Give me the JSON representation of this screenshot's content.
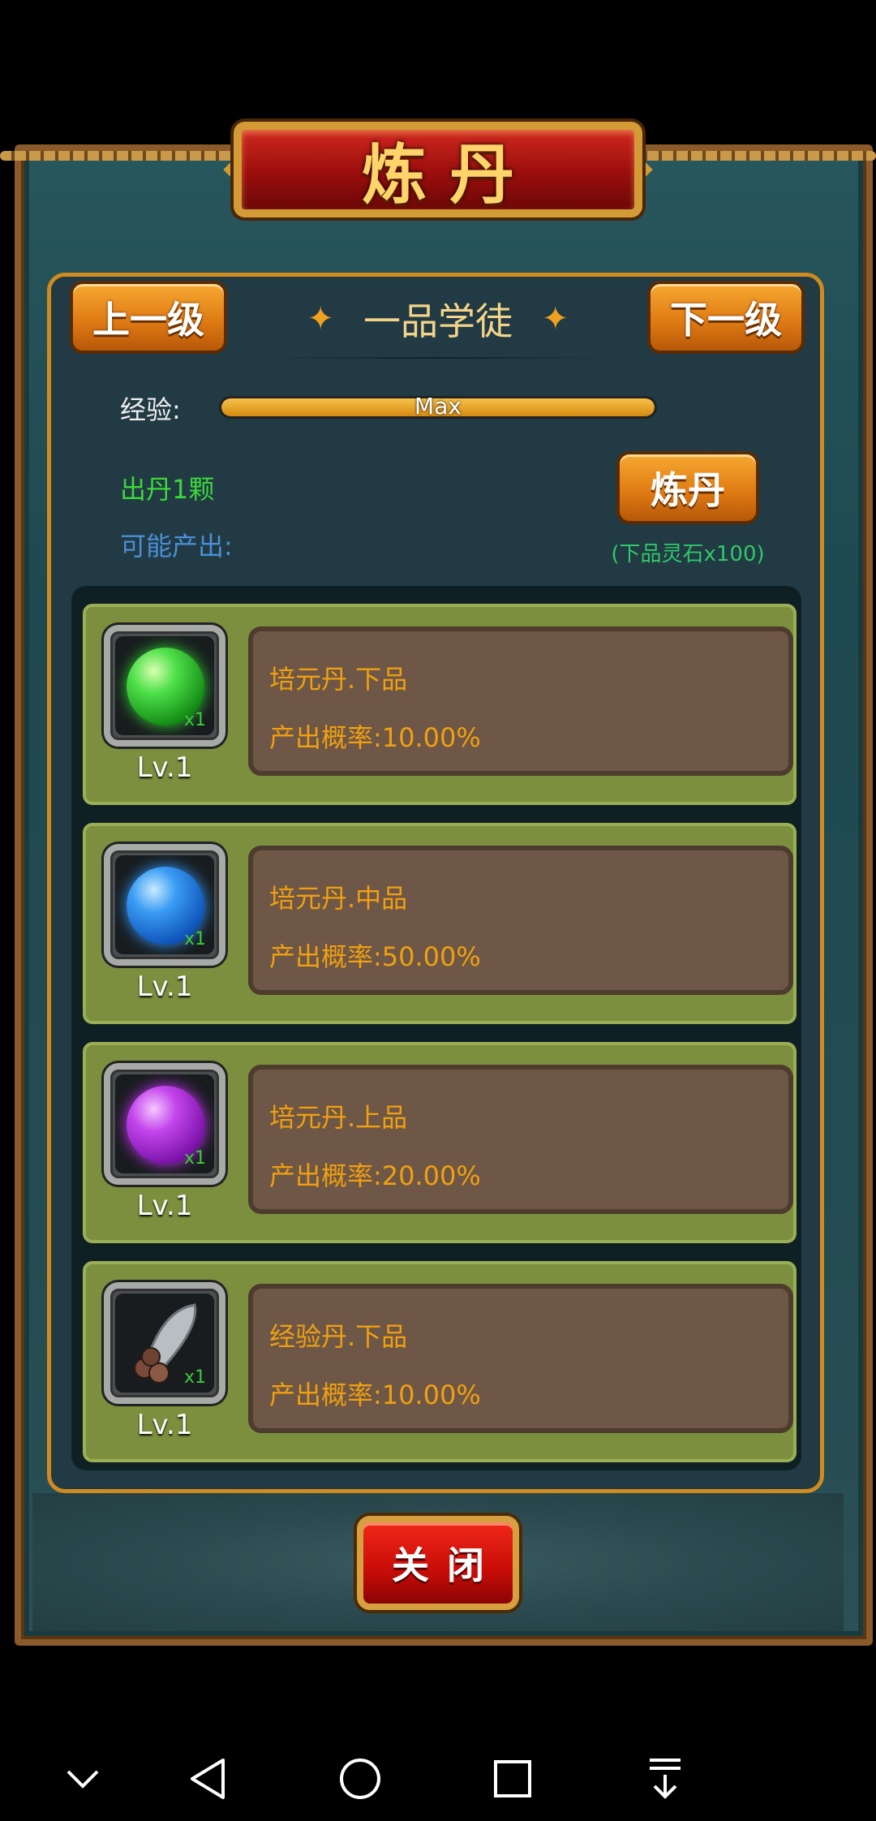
{
  "title": "炼丹",
  "nav": {
    "prev_label": "上一级",
    "next_label": "下一级",
    "rank": "一品学徒"
  },
  "exp": {
    "label": "经验:",
    "value_text": "Max",
    "fill_fraction": 1.0
  },
  "yield_text": "出丹1颗",
  "possible_label": "可能产出:",
  "refine": {
    "label": "炼丹",
    "cost": "(下品灵石x100)"
  },
  "items": [
    {
      "name": "培元丹.下品",
      "rate": "产出概率:10.00%",
      "level": "Lv.1",
      "qty": "x1",
      "color": "#32d232",
      "icon": "green-pill-icon"
    },
    {
      "name": "培元丹.中品",
      "rate": "产出概率:50.00%",
      "level": "Lv.1",
      "qty": "x1",
      "color": "#2f8ef0",
      "icon": "blue-pill-icon"
    },
    {
      "name": "培元丹.上品",
      "rate": "产出概率:20.00%",
      "level": "Lv.1",
      "qty": "x1",
      "color": "#b630e0",
      "icon": "purple-pill-icon"
    },
    {
      "name": "经验丹.下品",
      "rate": "产出概率:10.00%",
      "level": "Lv.1",
      "qty": "x1",
      "color": "#b8bec2",
      "icon": "exp-pill-icon"
    }
  ],
  "close_label": "关闭"
}
